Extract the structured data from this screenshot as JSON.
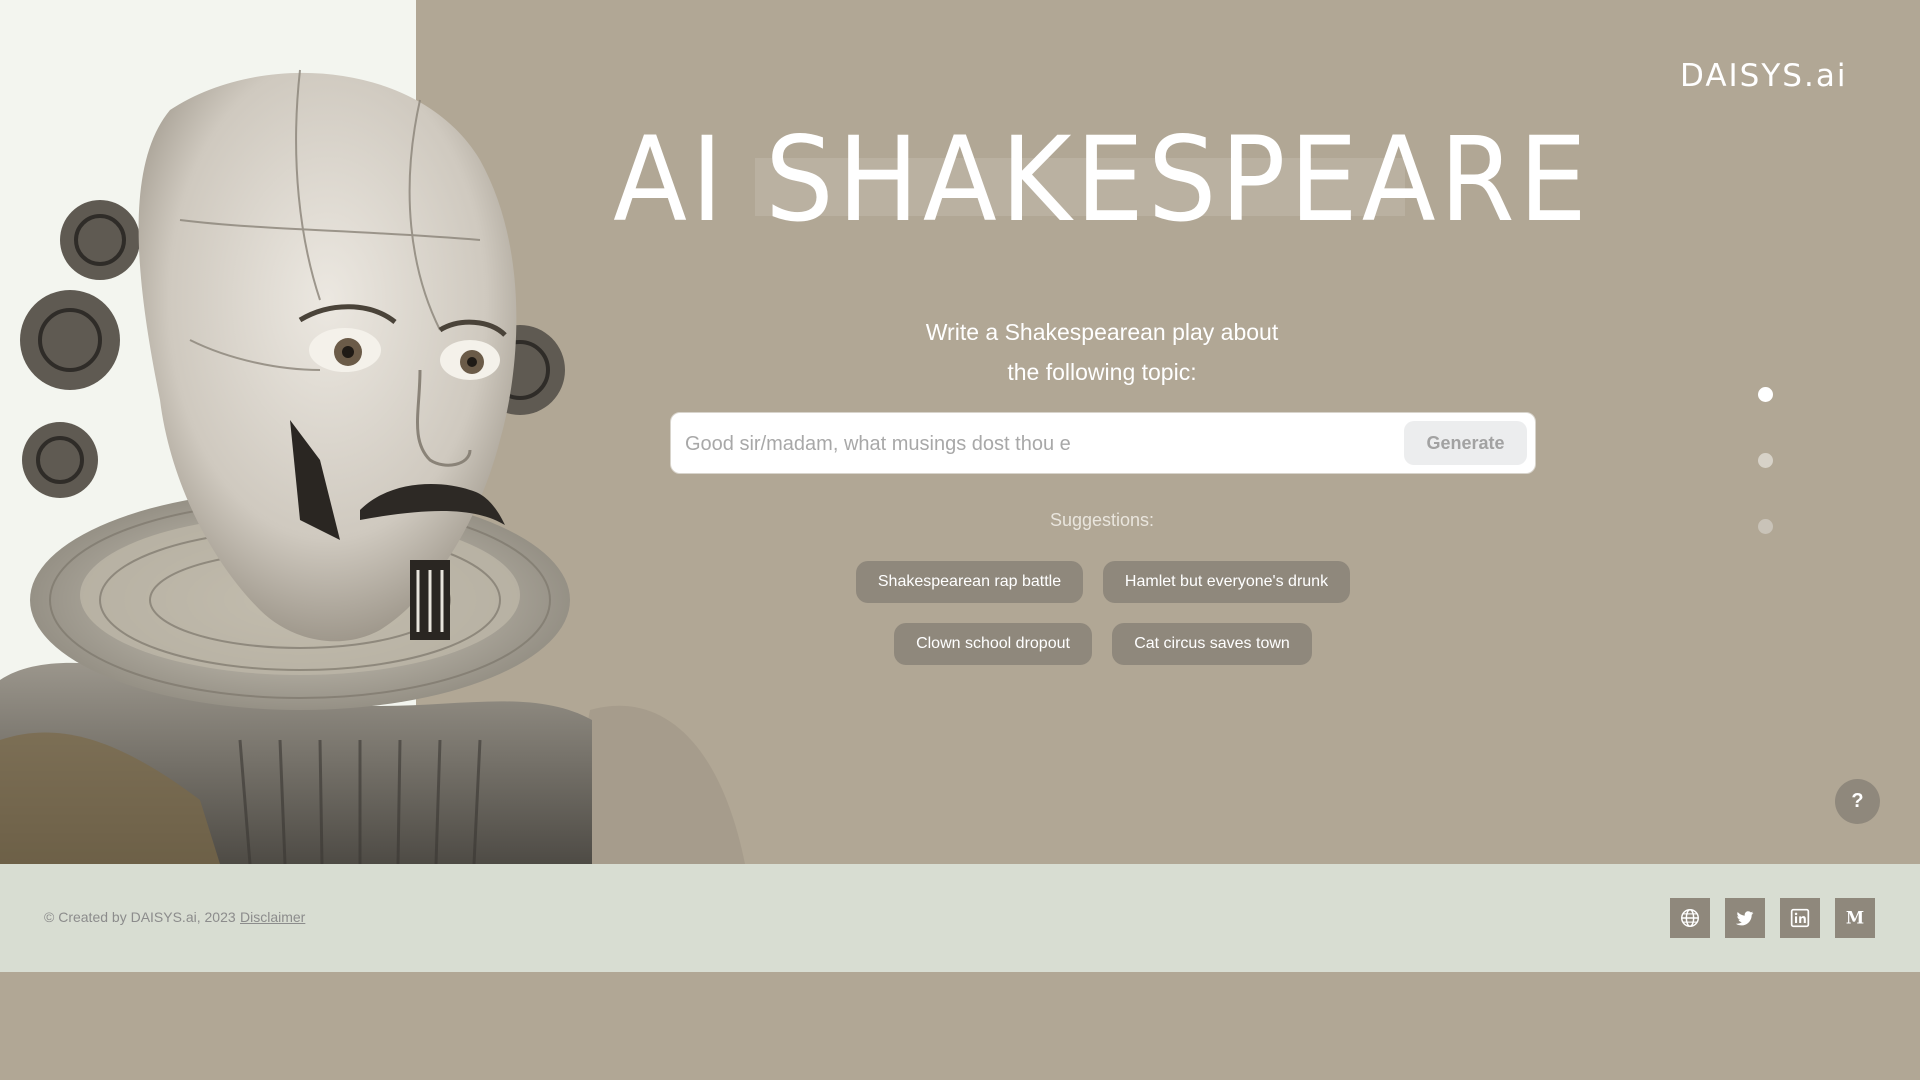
{
  "brand": {
    "logo_text": "DAISYS.ai"
  },
  "hero": {
    "title": "AI SHAKESPEARE",
    "prompt_line_1": "Write a Shakespearean play about",
    "prompt_line_2": "the following topic:"
  },
  "search": {
    "placeholder": "Good sir/madam, what musings dost thou e",
    "value": "",
    "generate_label": "Generate"
  },
  "suggestions": {
    "label": "Suggestions:",
    "items": [
      "Shakespearean rap battle",
      "Hamlet but everyone's drunk",
      "Clown school dropout",
      "Cat circus saves town"
    ]
  },
  "pager": {
    "active_index": 0,
    "count": 3
  },
  "help": {
    "label": "?"
  },
  "footer": {
    "credit": "© Created by DAISYS.ai, 2023",
    "disclaimer": "Disclaimer",
    "social_icons": [
      "globe-icon",
      "twitter-icon",
      "linkedin-icon",
      "medium-icon"
    ]
  },
  "colors": {
    "background": "#b1a795",
    "left_panel": "#f3f5ef",
    "chip": "#8f887c",
    "footer": "#d8ddd2",
    "white": "#ffffff"
  }
}
